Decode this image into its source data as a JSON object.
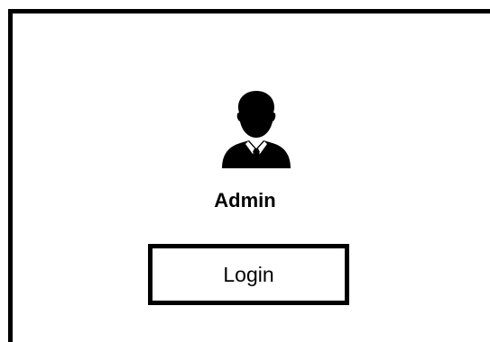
{
  "user": {
    "avatar_icon": "user-tie-icon",
    "role": "Admin"
  },
  "actions": {
    "login_label": "Login"
  },
  "colors": {
    "foreground": "#000000",
    "background": "#ffffff"
  }
}
